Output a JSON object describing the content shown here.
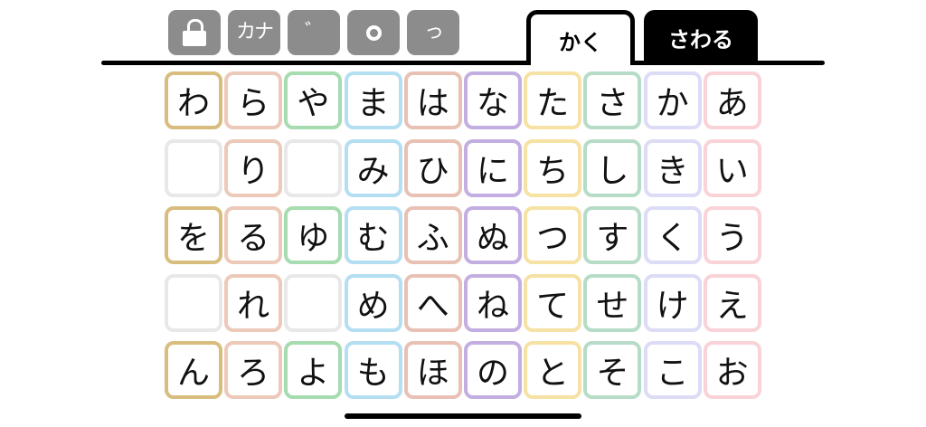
{
  "toolbar": {
    "buttons": [
      {
        "icon": "lock-icon",
        "label": ""
      },
      {
        "icon": "katakana-icon",
        "label": "カナ"
      },
      {
        "icon": "dakuten-icon",
        "label": "゛"
      },
      {
        "icon": "handakuten-icon",
        "label": ""
      },
      {
        "icon": "small-tsu-icon",
        "label": "っ"
      }
    ],
    "button_color": "#8c8c8c"
  },
  "tabs": [
    {
      "label": "かく",
      "state": "active"
    },
    {
      "label": "さわる",
      "state": "inactive"
    }
  ],
  "kana_grid": {
    "columns": [
      {
        "name": "wa",
        "color": "#d8bd7e",
        "keys": [
          "わ",
          "",
          "を",
          "",
          "ん"
        ]
      },
      {
        "name": "ra",
        "color": "#ecc9b8",
        "keys": [
          "ら",
          "り",
          "る",
          "れ",
          "ろ"
        ]
      },
      {
        "name": "ya",
        "color": "#a7dbb0",
        "keys": [
          "や",
          "",
          "ゆ",
          "",
          "よ"
        ]
      },
      {
        "name": "ma",
        "color": "#b4def2",
        "keys": [
          "ま",
          "み",
          "む",
          "め",
          "も"
        ]
      },
      {
        "name": "ha",
        "color": "#e8c1b4",
        "keys": [
          "は",
          "ひ",
          "ふ",
          "へ",
          "ほ"
        ]
      },
      {
        "name": "na",
        "color": "#c3aee1",
        "keys": [
          "な",
          "に",
          "ぬ",
          "ね",
          "の"
        ]
      },
      {
        "name": "ta",
        "color": "#f6e2a4",
        "keys": [
          "た",
          "ち",
          "つ",
          "て",
          "と"
        ]
      },
      {
        "name": "sa",
        "color": "#b6dcc8",
        "keys": [
          "さ",
          "し",
          "す",
          "せ",
          "そ"
        ]
      },
      {
        "name": "ka",
        "color": "#dcdcf7",
        "keys": [
          "か",
          "き",
          "く",
          "け",
          "こ"
        ]
      },
      {
        "name": "a",
        "color": "#f9d3d8",
        "keys": [
          "あ",
          "い",
          "う",
          "え",
          "お"
        ]
      }
    ],
    "empty_key_color": "#e8e8e8"
  }
}
